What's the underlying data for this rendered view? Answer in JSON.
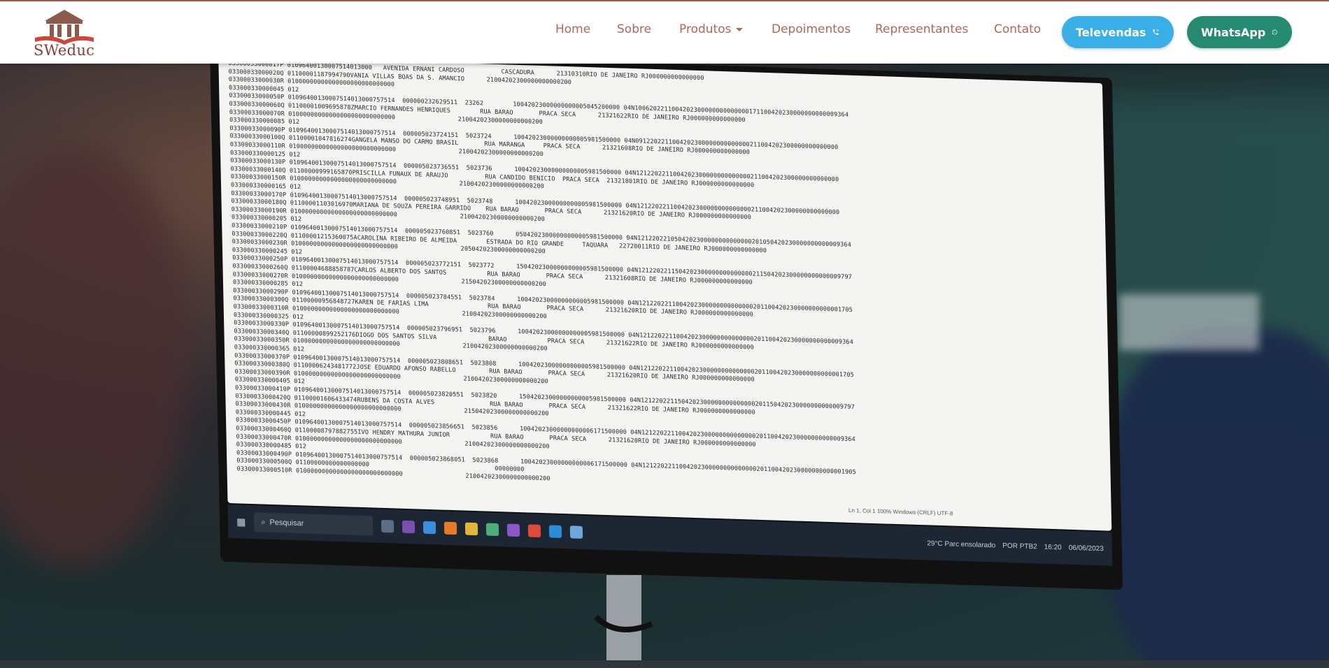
{
  "brand": {
    "name": "SWeduc",
    "logo_icon": "building-book-icon"
  },
  "nav": {
    "items": [
      {
        "label": "Home"
      },
      {
        "label": "Sobre"
      },
      {
        "label": "Produtos"
      },
      {
        "label": "Depoimentos"
      },
      {
        "label": "Representantes"
      },
      {
        "label": "Contato"
      }
    ],
    "televendas_label": "Televendas",
    "whatsapp_label": "WhatsApp"
  },
  "colors": {
    "accent": "#a9564a",
    "nav_text": "#b06658",
    "televendas": "#3aaee6",
    "whatsapp": "#268a72"
  },
  "hero_screen": {
    "lines": [
      "03300033000017P 01096400130007514013000   AVENIDA ERNANI CARDOSO          CASCADURA      21310310RIO DE JANEIRO RJ000000000000000",
      "03300033000020Q 01100001187994790VANIA VILLAS BOAS DA S. AMANCIO      21004202300000000000200",
      "03300033000030R 01000000000000000000000000000",
      "033000330000045 012",
      "03300033000050P 01096400130007514013000757514  000000232629511  23262        10042023000000000005045200000 04N1006202211004202300000000000000171100420230000000000009364",
      "03300033000060Q 01100001009695878ZMARCIO FERNANDES HENRIQUES        RUA BARAO       PRACA SECA      21321622RIO DE JANEIRO RJ000000000000000",
      "03300033000070R 01000000000000000000000000000                 21004202300000000000200",
      "033000330000085 012",
      "03300033000090P 01096400130007514013000757514  000005023724151  5023724      10042023000000000005981500000 04N0912202211004202300000000000000211004202300000000000000",
      "03300033000100Q 01100001047816274GANGELA MANSO DO CARMO BRASIL       RUA MARANGA     PRACA SECA      21321608RIO DE JANEIRO RJ000000000000000",
      "03300033000110R 01000000000000000000000000000                 21004202300000000000200",
      "033000330000125 012",
      "03300033000130P 01096400130007514013000757514  000005023736551  5023736      10042023000000000005981500000 04N1212202211004202300000000000000211004202300000000000000",
      "03300033000140Q 01100000999165870PRISCILLA FUNAUX DE ARAUJO          RUA CANDIDO BENICIO  PRACA SECA  21321801RIO DE JANEIRO RJ000000000000000",
      "03300033000150R 01000000000000000000000000000                 21004202300000000000200",
      "033000330000165 012",
      "03300033000170P 01096400130007514013000757514  000005023748951  5023748      10042023000000000005981500000 04N1212202211004202300000000000000211004202300000000000000",
      "03300033000180Q 01100001103016970MARIANA DE SOUZA PEREIRA GARRIDO    RUA BARAO       PRACA SECA      21321620RIO DE JANEIRO RJ000000000000000",
      "03300033000190R 01000000000000000000000000000                 21004202300000000000200",
      "033000330000205 012",
      "03300033000210P 01096400130007514013000757514  000005023760851  5023760      05042023000000000005981500000 04N1212202210504202300000000000000201050420230000000000009364",
      "03300033000220Q 01100001215360075ACAROLINA RIBEIRO DE ALMEIDA        ESTRADA DO RIO GRANDE     TAQUARA   22720011RIO DE JANEIRO RJ000000000000000",
      "03300033000230R 01000000000000000000000000000                 20504202300000000000200",
      "033000330000245 012",
      "03300033000250P 01096400130007514013000757514  000005023772151  5023772      15042023000000000005981500000 04N1212202211504202300000000000000211504202300000000000009797",
      "03300033000260Q 01100004688858787CARLOS ALBERTO DOS SANTOS           RUA BARAO       PRACA SECA      21321608RIO DE JANEIRO RJ000000000000000",
      "03300033000270R 01000000000000000000000000000                 21504202300000000000200",
      "033000330000285 012",
      "03300033000290P 01096400130007514013000757514  000005023784551  5023784      10042023000000000005981500000 04N1212202211004202300000000000000201100420230000000000001705",
      "03300033000300Q 01100000956848727KAREN DE FARIAS LIMA                RUA BARAO       PRACA SECA      21321620RIO DE JANEIRO RJ000000000000000",
      "03300033000310R 01000000000000000000000000000                 21004202300000000000200",
      "033000330000325 012",
      "03300033000330P 01096400130007514013000757514  000005023796951  5023796      10042023000000000005981500000 04N1212202211004202300000000000000201100420230000000000009364",
      "03300033000340Q 01100000899252176DIOGO DOS SANTOS SILVA              BARAO           PRACA SECA      21321622RIO DE JANEIRO RJ000000000000000",
      "03300033000350R 01000000000000000000000000000                 21004202300000000000200",
      "033000330000365 012",
      "03300033000370P 01096400130007514013000757514  000005023808651  5023808      10042023000000000005981500000 04N1212202211004202300000000000000201100420230000000000001705",
      "03300033000380Q 01100006243481772JOSE EDUARDO AFONSO RABELLO         RUA BARAO       PRACA SECA      21321620RIO DE JANEIRO RJ000000000000000",
      "03300033000390R 01000000000000000000000000000                 21004202300000000000200",
      "033000330000405 012",
      "03300033000410P 01096400130007514013000757514  000005023820551  5023820      15042023000000000005981500000 04N1212202211504202300000000000000201150420230000000000009797",
      "03300033000420Q 01100001606433474RUBENS DA COSTA ALVES               RUA BARAO       PRACA SECA      21321622RIO DE JANEIRO RJ000000000000000",
      "03300033000430R 01000000000000000000000000000                 21504202300000000000200",
      "033000330000445 012",
      "03300033000450P 01096400130007514013000757514  000005023856651  5023856      10042023000000000006171500000 04N1212202211004202300000000000000201100420230000000000009364",
      "03300033000460Q 01100008797882755IVO HENDRY MATHURA JUNIOR           RUA BARAO       PRACA SECA      21321620RIO DE JANEIRO RJ000000000000000",
      "03300033000470R 01000000000000000000000000000                 21004202300000000000200",
      "033000330000485 012",
      "03300033000490P 01096400130007514013000757514  000005023868051  5023868      10042023000000000006171500000 04N1212202211004202300000000000000201100420230000000000001905",
      "03300033000500Q 01100000000000000000                                  00000000",
      "03300033000510R 01000000000000000000000000000                 21004202300000000000200"
    ],
    "status_bar": "Ln 1, Col 1     100%     Windows (CRLF)     UTF-8",
    "taskbar_search": "Pesquisar",
    "weather": "29°C  Parc ensolarado",
    "lang": "POR PTB2",
    "time": "16:20",
    "date": "06/06/2023"
  }
}
